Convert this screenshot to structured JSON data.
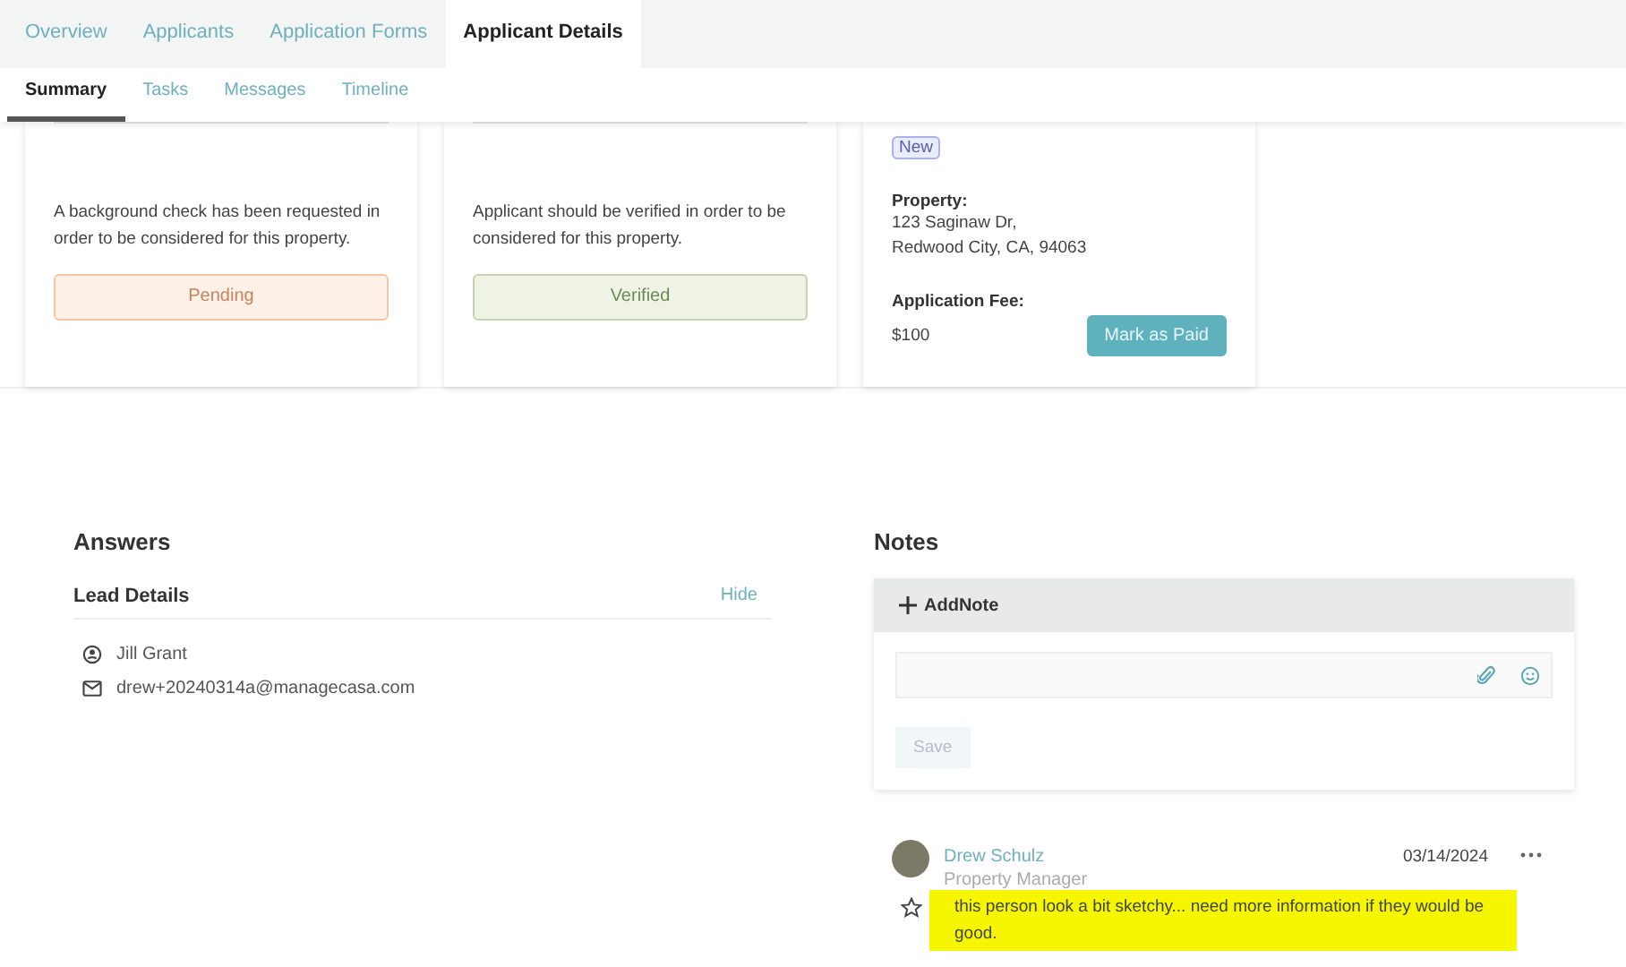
{
  "top_tabs": [
    {
      "label": "Overview",
      "selected": false
    },
    {
      "label": "Applicants",
      "selected": false
    },
    {
      "label": "Application Forms",
      "selected": false
    },
    {
      "label": "Applicant Details",
      "selected": true
    }
  ],
  "sub_tabs": [
    {
      "label": "Summary",
      "selected": true
    },
    {
      "label": "Tasks",
      "selected": false
    },
    {
      "label": "Messages",
      "selected": false
    },
    {
      "label": "Timeline",
      "selected": false
    }
  ],
  "cards": [
    {
      "kind": "status",
      "description": "A background check has been requested in order to be considered for this property.",
      "status": {
        "label": "Pending",
        "kind": "pending"
      }
    },
    {
      "kind": "status",
      "description": "Applicant should be verified in order to be considered for this property.",
      "status": {
        "label": "Verified",
        "kind": "verified"
      }
    },
    {
      "kind": "info",
      "badge": "New",
      "property_label": "Property:",
      "property_lines": [
        "123 Saginaw Dr,",
        "Redwood City, CA, 94063"
      ],
      "fee_label": "Application Fee:",
      "fee": "$100",
      "button": "Mark as Paid"
    }
  ],
  "answers": {
    "title": "Answers",
    "section": "Lead Details",
    "toggle": "Hide",
    "details": [
      {
        "kind": "person",
        "text": "Jill Grant"
      },
      {
        "kind": "email",
        "text": "drew+20240314a@managecasa.com"
      }
    ]
  },
  "notes": {
    "title": "Notes",
    "add_note": "AddNote",
    "save": "Save",
    "save_disabled": true,
    "items": [
      {
        "author": "Drew Schulz",
        "role": "Property Manager",
        "date": "03/14/2024",
        "text": "this person look a bit sketchy... need more information if they would be good.",
        "starred": false,
        "highlighted": true
      }
    ]
  }
}
